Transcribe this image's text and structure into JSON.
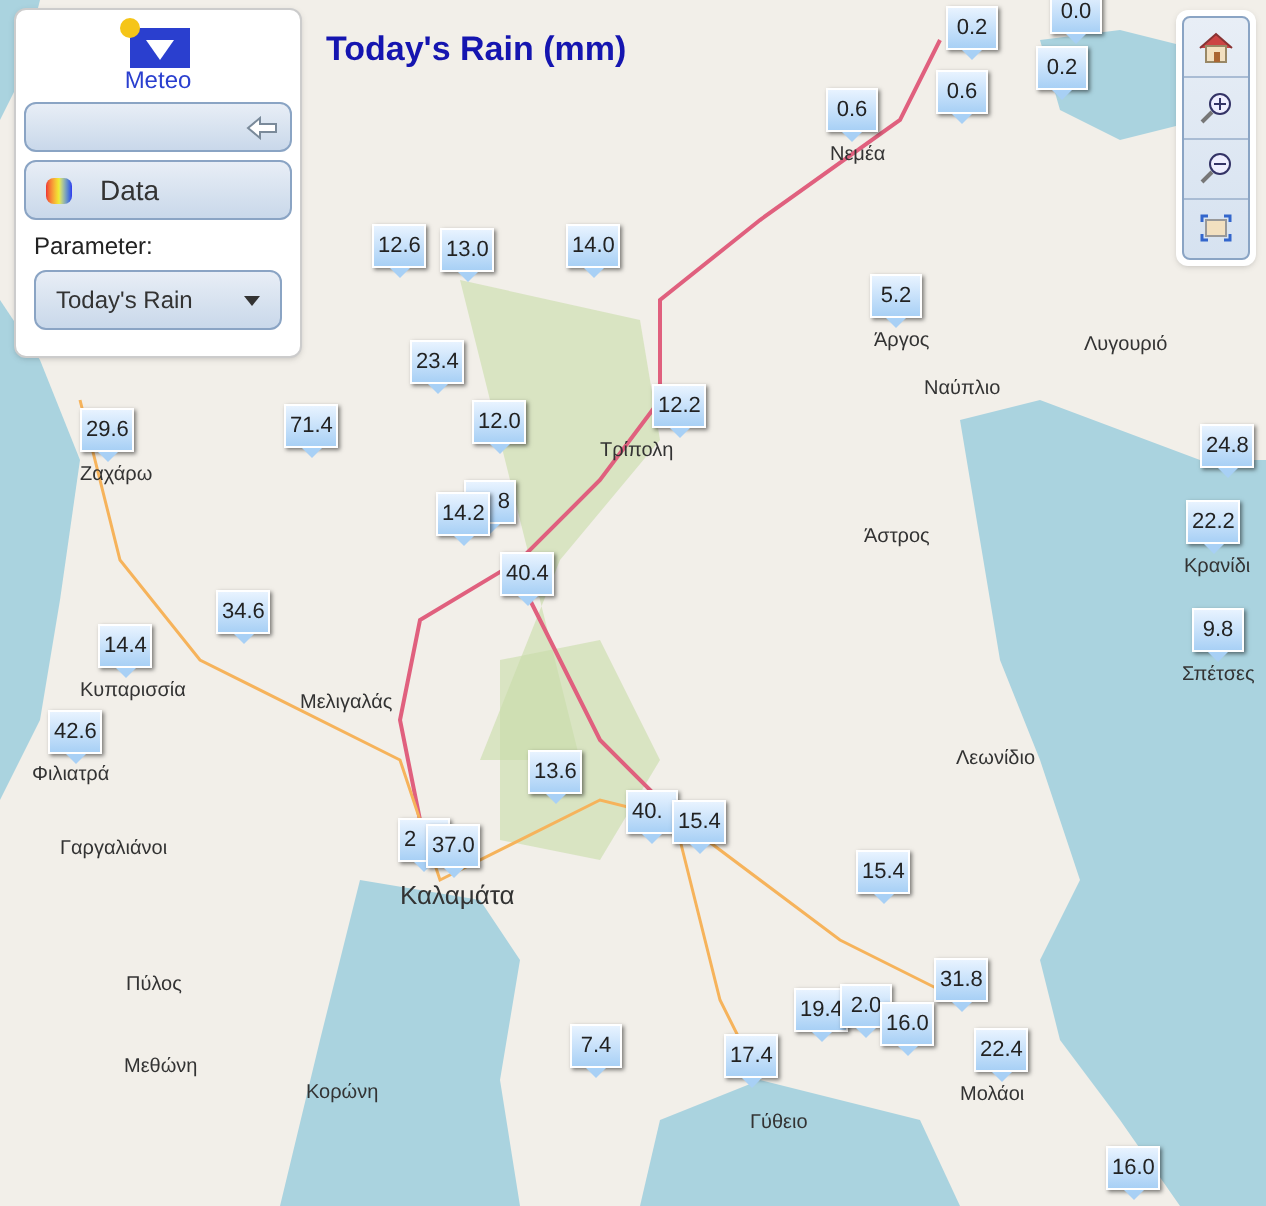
{
  "title": "Today's Rain (mm)",
  "panel": {
    "logo_text": "Meteo",
    "data_button": "Data",
    "parameter_label": "Parameter:",
    "parameter_value": "Today's Rain"
  },
  "map_labels": [
    "Ζαχάρω",
    "Νεμέα",
    "Άργος",
    "Ναύπλιο",
    "Λυγουριό",
    "Τρίπολη",
    "Άστρος",
    "Κρανίδι",
    "Σπέτσες",
    "Μελιγαλάς",
    "Κυπαρισσία",
    "Φιλιατρά",
    "Λεωνίδιο",
    "Γαργαλιάνοι",
    "Καλαμάτα",
    "Πύλος",
    "Μεθώνη",
    "Κορώνη",
    "Γύθειο",
    "Μολάοι"
  ],
  "markers": [
    "0.0",
    "0.2",
    "0.2",
    "0.6",
    "0.6",
    "12.6",
    "13.0",
    "14.0",
    "23.4",
    "12.0",
    "12.2",
    "5.2",
    "24.8",
    "22.2",
    "9.8",
    "29.6",
    "71.4",
    "8",
    "14.2",
    "40.4",
    "34.6",
    "14.4",
    "42.6",
    "13.6",
    "2",
    "37.0",
    "40.",
    "15.4",
    "15.4",
    "31.8",
    "19.4",
    "2.0",
    "16.0",
    "7.4",
    "17.4",
    "22.4",
    "16.0"
  ]
}
